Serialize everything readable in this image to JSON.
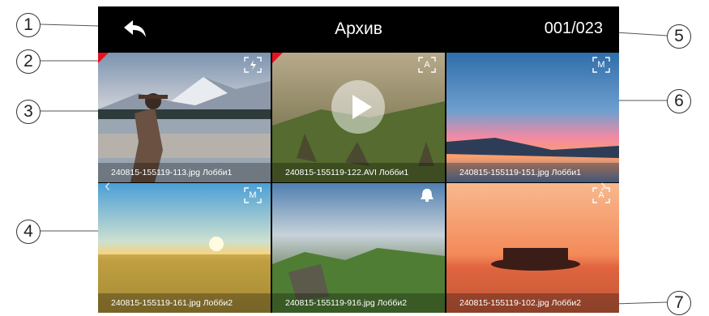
{
  "header": {
    "title": "Архив",
    "counter": "001/023",
    "back_icon": "back-arrow-icon"
  },
  "tiles": [
    {
      "caption": "240815-155119-113.jpg  Лобби1",
      "mode": "",
      "mode_icon": "auto-capture-icon",
      "recorded": true,
      "video": false
    },
    {
      "caption": "240815-155119-122.AVI  Лобби1",
      "mode": "A",
      "mode_icon": "",
      "recorded": true,
      "video": true
    },
    {
      "caption": "240815-155119-151.jpg  Лобби1",
      "mode": "M",
      "mode_icon": "",
      "recorded": false,
      "video": false
    },
    {
      "caption": "240815-155119-161.jpg  Лобби2",
      "mode": "M",
      "mode_icon": "",
      "recorded": false,
      "video": false
    },
    {
      "caption": "240815-155119-916.jpg  Лобби2",
      "mode": "",
      "mode_icon": "alarm-bell-icon",
      "recorded": false,
      "video": false
    },
    {
      "caption": "240815-155119-102.jpg  Лобби2",
      "mode": "A",
      "mode_icon": "",
      "recorded": false,
      "video": false
    }
  ],
  "callouts": [
    "1",
    "2",
    "3",
    "4",
    "5",
    "6",
    "7"
  ],
  "colors": {
    "background": "#000000",
    "text": "#ffffff",
    "new_marker": "#e8101f"
  }
}
